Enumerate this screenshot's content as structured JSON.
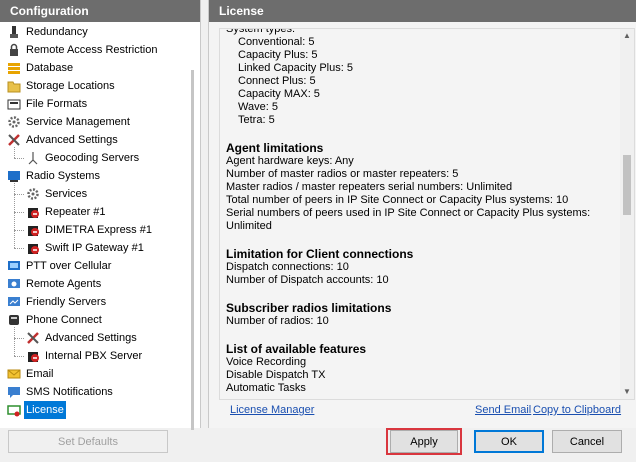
{
  "left_panel": {
    "title": "Configuration",
    "items": [
      {
        "label": "Redundancy",
        "icon": "redundancy-icon",
        "level": 0
      },
      {
        "label": "Remote Access Restriction",
        "icon": "lock-icon",
        "level": 0
      },
      {
        "label": "Database",
        "icon": "database-icon",
        "level": 0
      },
      {
        "label": "Storage Locations",
        "icon": "folder-icon",
        "level": 0
      },
      {
        "label": "File Formats",
        "icon": "file-formats-icon",
        "level": 0
      },
      {
        "label": "Service Management",
        "icon": "gear-icon",
        "level": 0
      },
      {
        "label": "Advanced Settings",
        "icon": "tools-icon",
        "level": 0
      },
      {
        "label": "Geocoding Servers",
        "icon": "geocoding-icon",
        "level": 1
      },
      {
        "label": "Radio Systems",
        "icon": "radio-systems-icon",
        "level": 0
      },
      {
        "label": "Services",
        "icon": "gear-icon",
        "level": 1
      },
      {
        "label": "Repeater #1",
        "icon": "repeater-icon",
        "level": 1
      },
      {
        "label": "DIMETRA Express #1",
        "icon": "repeater-icon",
        "level": 1
      },
      {
        "label": "Swift IP Gateway #1",
        "icon": "repeater-icon",
        "level": 1
      },
      {
        "label": "PTT over Cellular",
        "icon": "ptt-icon",
        "level": 0
      },
      {
        "label": "Remote Agents",
        "icon": "remote-agents-icon",
        "level": 0
      },
      {
        "label": "Friendly Servers",
        "icon": "servers-icon",
        "level": 0
      },
      {
        "label": "Phone Connect",
        "icon": "phone-icon",
        "level": 0
      },
      {
        "label": "Advanced Settings",
        "icon": "tools-icon",
        "level": 1
      },
      {
        "label": "Internal PBX Server",
        "icon": "pbx-icon",
        "level": 1
      },
      {
        "label": "Email",
        "icon": "email-icon",
        "level": 0
      },
      {
        "label": "SMS Notifications",
        "icon": "sms-icon",
        "level": 0
      },
      {
        "label": "License",
        "icon": "license-icon",
        "level": 0,
        "selected": true
      }
    ]
  },
  "right_panel": {
    "title": "License",
    "system_types_label": "System types:",
    "system_types": [
      "Conventional: 5",
      "Capacity Plus: 5",
      "Linked Capacity Plus: 5",
      "Connect Plus: 5",
      "Capacity MAX: 5",
      "Wave: 5",
      "Tetra: 5"
    ],
    "sections": [
      {
        "heading": "Agent limitations",
        "lines": [
          "Agent hardware keys: Any",
          "Number of master radios or master repeaters: 5",
          "Master radios / master repeaters serial numbers: Unlimited",
          "Total number of peers in IP Site Connect or Capacity Plus systems: 10",
          "Serial numbers of peers used in IP Site Connect or Capacity Plus systems:",
          "Unlimited"
        ]
      },
      {
        "heading": "Limitation for Client connections",
        "lines": [
          "Dispatch connections: 10",
          "Number of Dispatch accounts: 10"
        ]
      },
      {
        "heading": "Subscriber radios limitations",
        "lines": [
          "Number of radios: 10"
        ]
      },
      {
        "heading": "List of available features",
        "lines": [
          "Voice Recording",
          "Disable Dispatch TX",
          "Automatic Tasks"
        ]
      }
    ],
    "links": {
      "license_manager": "License Manager",
      "send_email": "Send Email",
      "copy_to_clipboard": "Copy to Clipboard"
    }
  },
  "buttons": {
    "set_defaults": "Set Defaults",
    "apply": "Apply",
    "ok": "OK",
    "cancel": "Cancel"
  },
  "colors": {
    "header_bg": "#6d6d6d",
    "selection": "#0078d7",
    "link": "#1a4fb0",
    "highlight": "#d9363e"
  }
}
